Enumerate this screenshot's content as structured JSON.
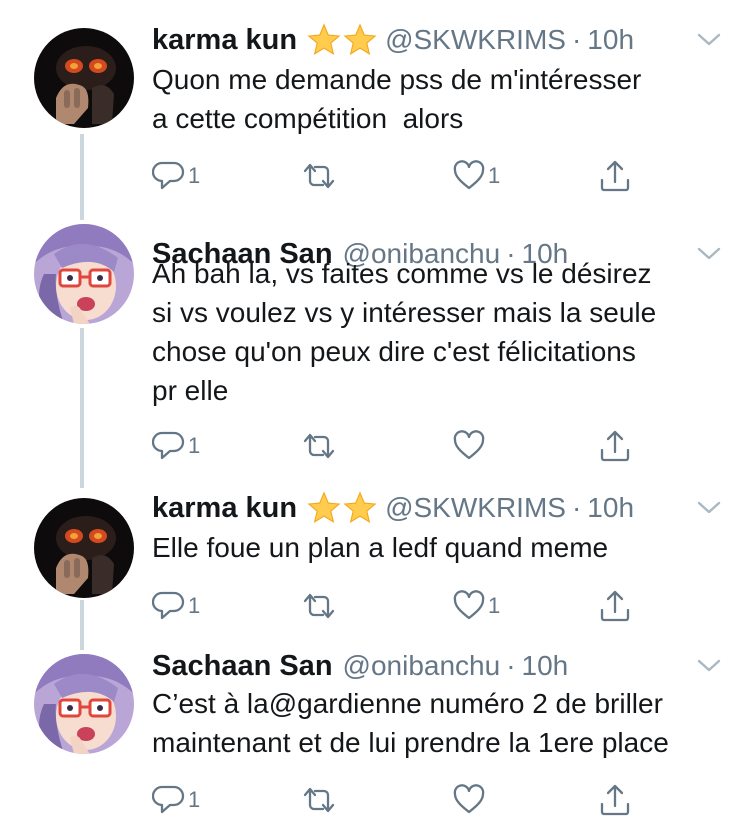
{
  "tweets": [
    {
      "name": "karma kun",
      "has_stars": true,
      "handle": "@SKWKRIMS",
      "sep": "·",
      "time": "10h",
      "text": "Quon me demande pss de m'intéresser\na cette compétition  alors",
      "reply_count": "1",
      "like_count": "1",
      "avatar_icon": "dark-character-avatar"
    },
    {
      "name": "Sachaan San",
      "has_stars": false,
      "handle": "@onibanchu",
      "sep": "·",
      "time": "10h",
      "text": "Ah bah la, vs faites comme vs le désirez\nsi vs voulez vs y intéresser mais la seule\nchose qu'on peux dire c'est félicitations\npr elle",
      "reply_count": "1",
      "like_count": "",
      "avatar_icon": "anime-glasses-avatar"
    },
    {
      "name": "karma kun",
      "has_stars": true,
      "handle": "@SKWKRIMS",
      "sep": "·",
      "time": "10h",
      "text": "Elle foue un plan a ledf quand meme",
      "reply_count": "1",
      "like_count": "1",
      "avatar_icon": "dark-character-avatar"
    },
    {
      "name": "Sachaan San",
      "has_stars": false,
      "handle": "@onibanchu",
      "sep": "·",
      "time": "10h",
      "text": "C’est à la@gardienne numéro 2 de briller\nmaintenant et de lui prendre la 1ere place",
      "reply_count": "1",
      "like_count": "",
      "avatar_icon": "anime-glasses-avatar"
    }
  ],
  "colors": {
    "text": "#14171a",
    "secondary": "#657786",
    "thread_line": "#ccd6dd",
    "star": "#ffcc4d"
  },
  "icons": {
    "reply": "reply-icon",
    "retweet": "retweet-icon",
    "like": "heart-icon",
    "share": "share-icon",
    "menu": "chevron-down-icon",
    "badge": "star-emoji-icon"
  }
}
